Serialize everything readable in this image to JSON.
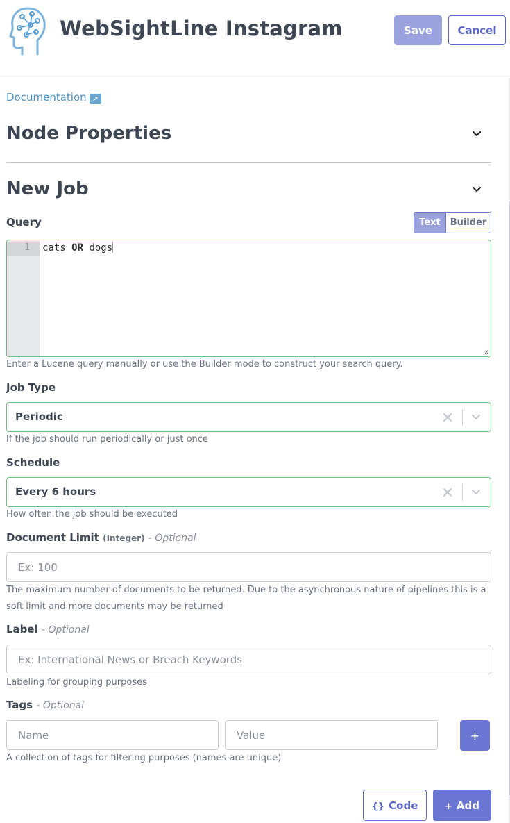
{
  "header": {
    "title": "WebSightLine Instagram",
    "save_label": "Save",
    "cancel_label": "Cancel",
    "logo_icon": "head-circuit-icon"
  },
  "documentation": {
    "link_label": "Documentation",
    "icon": "external-link-icon",
    "icon_glyph": "↗"
  },
  "sections": {
    "node_properties": "Node Properties",
    "new_job": "New Job"
  },
  "query": {
    "label": "Query",
    "mode_text": "Text",
    "mode_builder": "Builder",
    "active_mode": "Text",
    "line_number": "1",
    "code_before": "cats ",
    "code_keyword": "OR",
    "code_after": " dogs",
    "help": "Enter a Lucene query manually or use the Builder mode to construct your search query."
  },
  "job_type": {
    "label": "Job Type",
    "value": "Periodic",
    "help": "If the job should run periodically or just once"
  },
  "schedule": {
    "label": "Schedule",
    "value": "Every 6 hours",
    "help": "How often the job should be executed"
  },
  "document_limit": {
    "label": "Document Limit",
    "type": "(Integer)",
    "optional": "- Optional",
    "placeholder": "Ex: 100",
    "help": "The maximum number of documents to be returned. Due to the asynchronous nature of pipelines this is a soft limit and more documents may be returned"
  },
  "label_field": {
    "label": "Label",
    "optional": "- Optional",
    "placeholder": "Ex: International News or Breach Keywords",
    "help": "Labeling for grouping purposes"
  },
  "tags": {
    "label": "Tags",
    "optional": "- Optional",
    "name_placeholder": "Name",
    "value_placeholder": "Value",
    "add_glyph": "+",
    "help": "A collection of tags for filtering purposes (names are unique)"
  },
  "footer": {
    "code_icon": "{}",
    "code_label": "Code",
    "add_icon": "+",
    "add_label": "Add"
  },
  "colors": {
    "primary": "#6a76d2",
    "primary_disabled": "#9aa2dd",
    "valid_border": "#6ac27a",
    "link": "#4d8fbf"
  }
}
